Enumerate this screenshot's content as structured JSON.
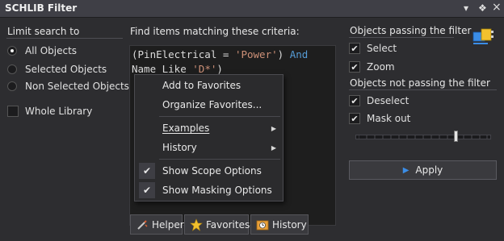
{
  "window": {
    "title": "SCHLIB Filter",
    "menu_icon": "▾",
    "pin_icon": "❖",
    "close_icon": "×"
  },
  "scope": {
    "heading": "Limit search to",
    "options": [
      "All Objects",
      "Selected Objects",
      "Non Selected Objects"
    ],
    "selected": "All Objects",
    "whole_library": {
      "label": "Whole Library",
      "checked": false
    }
  },
  "criteria": {
    "heading": "Find items matching these criteria:",
    "query_parts": {
      "p1": "(PinElectrical = ",
      "s1": "'Power'",
      "p2": ") ",
      "k1": "And",
      "p3": "Name Like ",
      "s2": "'D*'",
      "p4": ")"
    }
  },
  "context_menu": {
    "items": [
      {
        "label": "Add to Favorites"
      },
      {
        "label": "Organize Favorites..."
      },
      {
        "label": "Examples",
        "submenu": true
      },
      {
        "label": "History",
        "submenu": true
      },
      {
        "label": "Show Scope Options",
        "checked": true
      },
      {
        "label": "Show Masking Options",
        "checked": true
      }
    ],
    "submenu_arrow": "▶",
    "check_mark": "✔"
  },
  "bottom_tabs": {
    "helper": "Helper",
    "favorites": "Favorites",
    "history": "History"
  },
  "passing": {
    "heading": "Objects passing the filter",
    "select": {
      "label": "Select",
      "checked": true
    },
    "zoom": {
      "label": "Zoom",
      "checked": true
    }
  },
  "not_passing": {
    "heading": "Objects not passing the filter",
    "deselect": {
      "label": "Deselect",
      "checked": true
    },
    "mask_out": {
      "label": "Mask out",
      "checked": true
    },
    "mask_level": 0.75
  },
  "apply_button": {
    "label": "Apply"
  },
  "colors": {
    "accent": "#3b8de6",
    "string": "#ce9178",
    "keyword": "#569cd6",
    "background": "#2d2d30"
  }
}
